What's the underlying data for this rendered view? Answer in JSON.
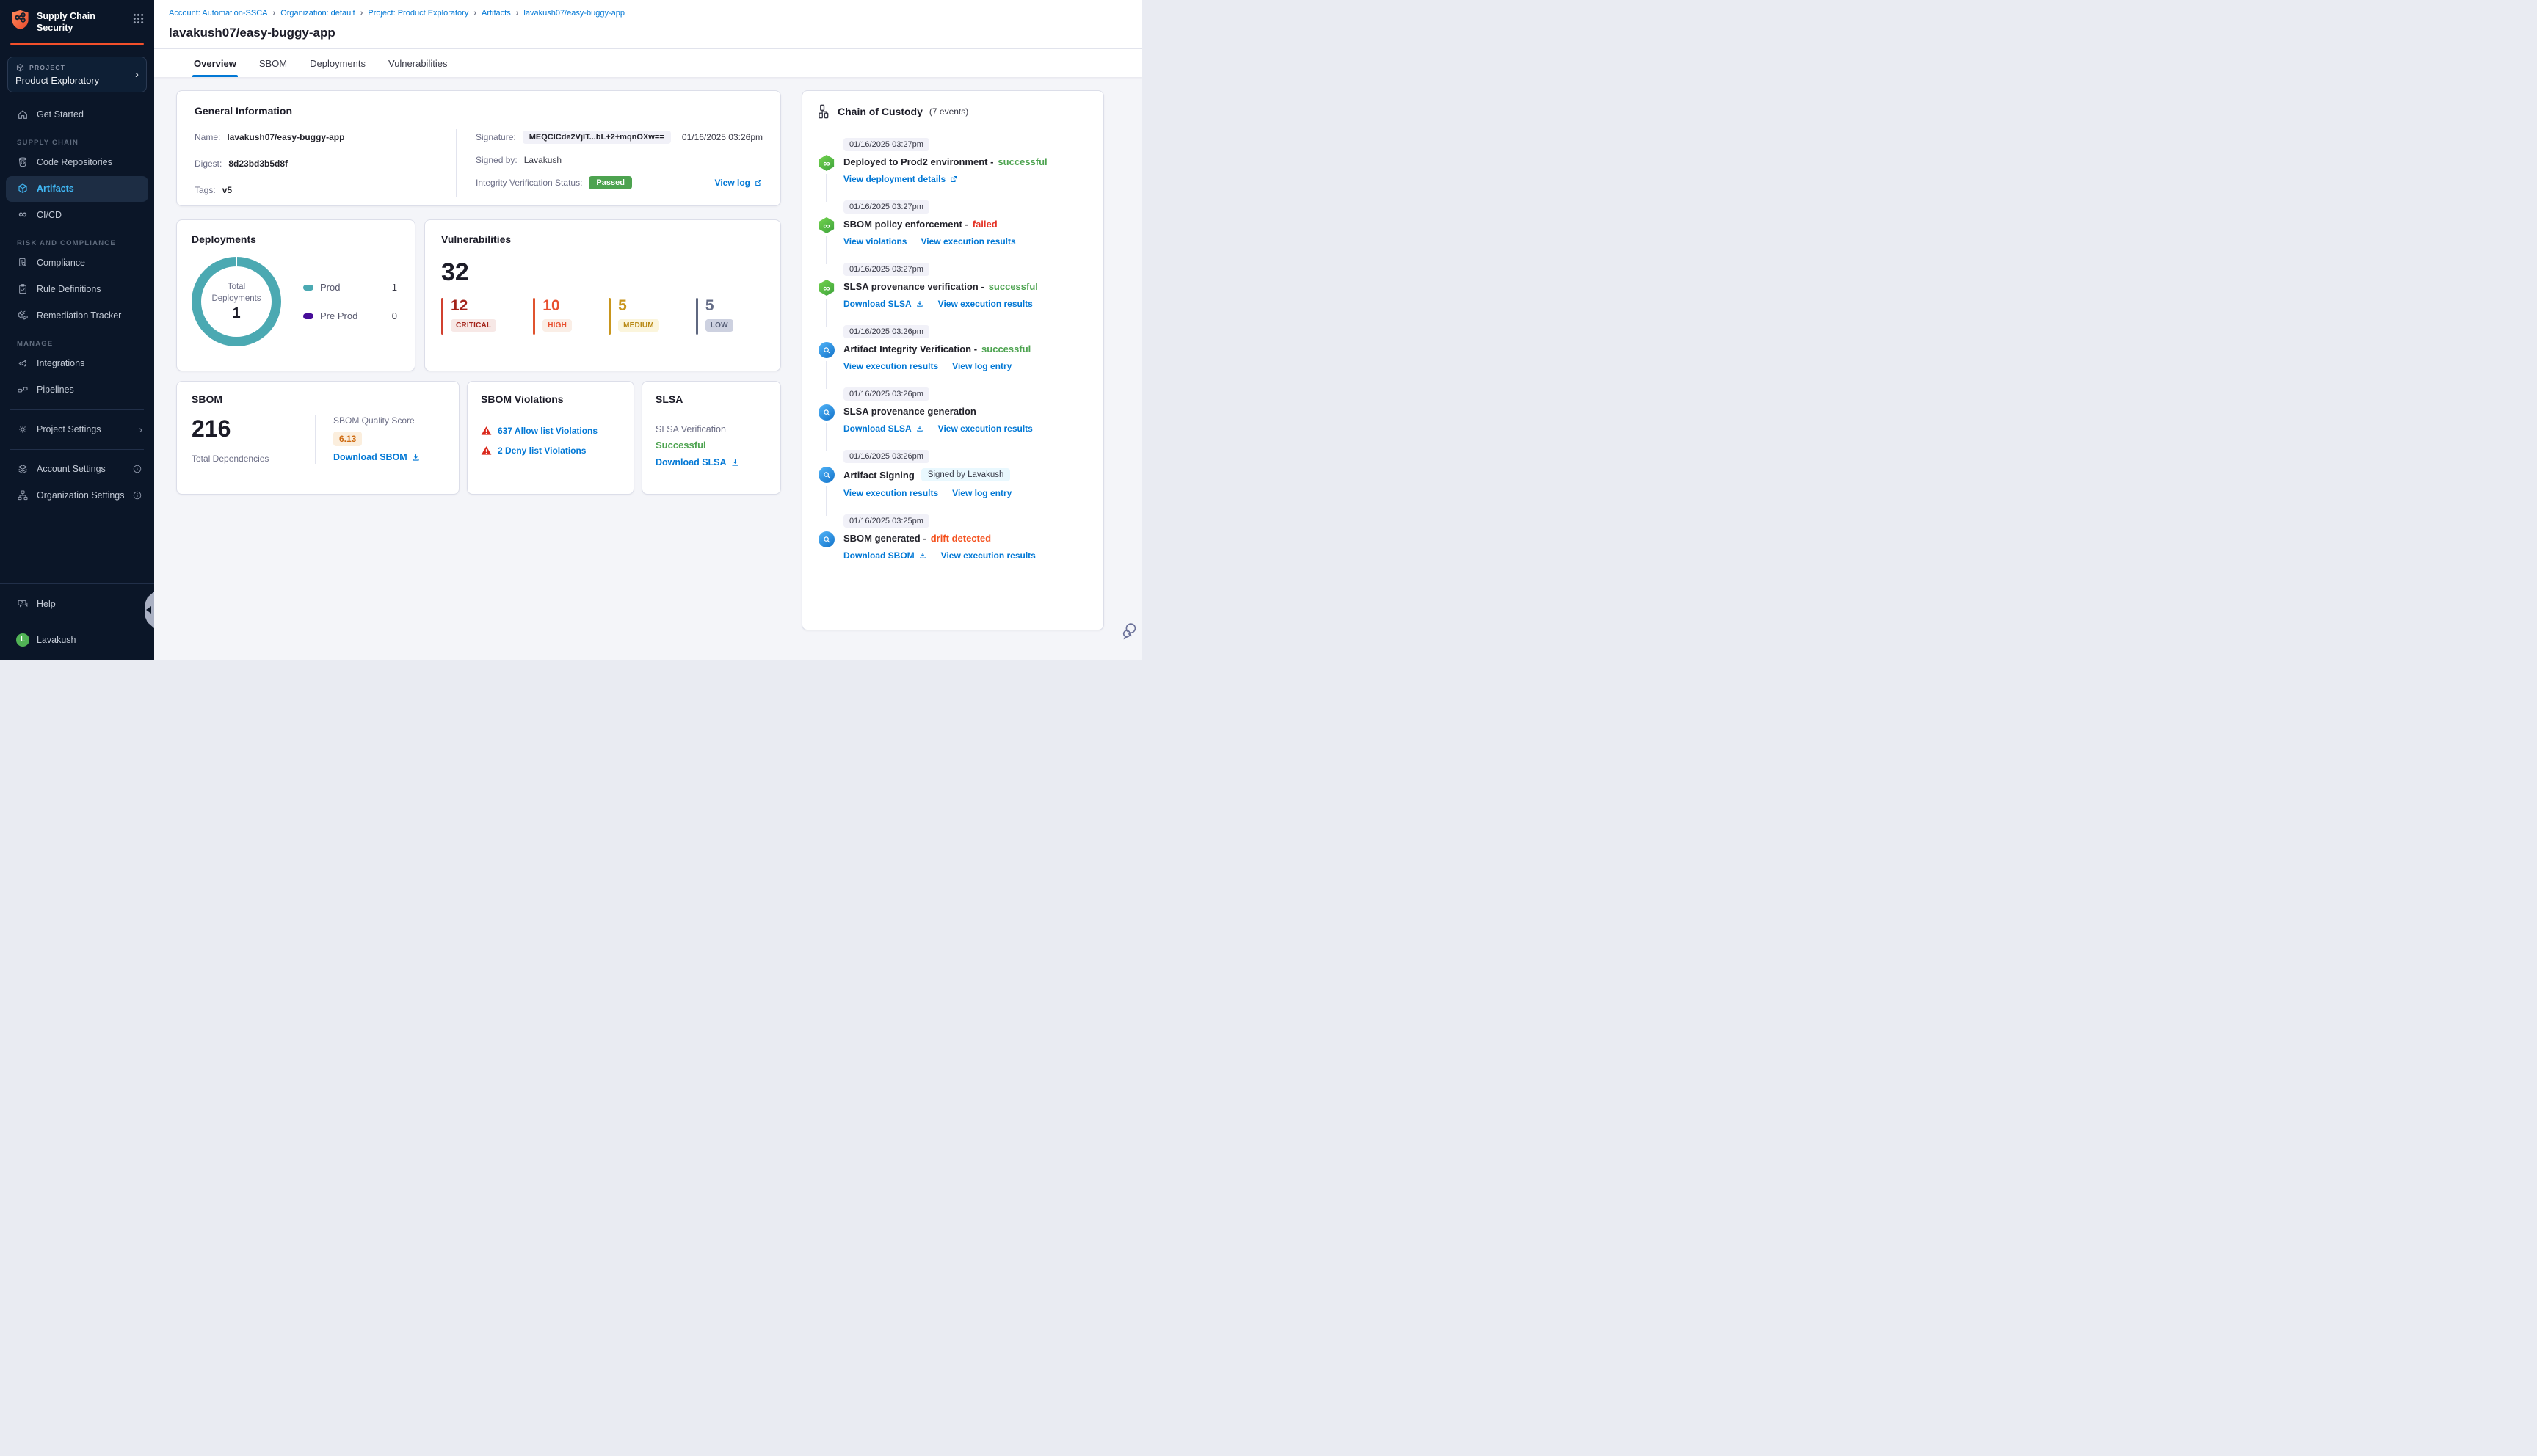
{
  "sidebar": {
    "app_title": "Supply Chain Security",
    "project_label": "PROJECT",
    "project_name": "Product Exploratory",
    "get_started_label": "Get Started",
    "sections": [
      {
        "label": "SUPPLY CHAIN",
        "items": [
          {
            "label": "Code Repositories"
          },
          {
            "label": "Artifacts"
          },
          {
            "label": "CI/CD"
          }
        ]
      },
      {
        "label": "RISK AND COMPLIANCE",
        "items": [
          {
            "label": "Compliance"
          },
          {
            "label": "Rule Definitions"
          },
          {
            "label": "Remediation Tracker"
          }
        ]
      },
      {
        "label": "MANAGE",
        "items": [
          {
            "label": "Integrations"
          },
          {
            "label": "Pipelines"
          }
        ]
      }
    ],
    "project_settings_label": "Project Settings",
    "account_settings_label": "Account Settings",
    "organization_settings_label": "Organization Settings",
    "help_label": "Help",
    "user_name": "Lavakush",
    "user_initial": "L"
  },
  "breadcrumb": {
    "items": [
      "Account: Automation-SSCA",
      "Organization: default",
      "Project: Product Exploratory",
      "Artifacts",
      "lavakush07/easy-buggy-app"
    ]
  },
  "page_title": "lavakush07/easy-buggy-app",
  "tabs": [
    "Overview",
    "SBOM",
    "Deployments",
    "Vulnerabilities"
  ],
  "general_info": {
    "title": "General Information",
    "name_label": "Name:",
    "name_value": "lavakush07/easy-buggy-app",
    "digest_label": "Digest:",
    "digest_value": "8d23bd3b5d8f",
    "tags_label": "Tags:",
    "tags_value": "v5",
    "signature_label": "Signature:",
    "signature_value": "MEQCICde2VjIT...bL+2+mqnOXw==",
    "signature_timestamp": "01/16/2025 03:26pm",
    "signed_by_label": "Signed by:",
    "signed_by_value": "Lavakush",
    "integrity_label": "Integrity Verification Status:",
    "integrity_status": "Passed",
    "view_log_label": "View log"
  },
  "deployments": {
    "title": "Deployments",
    "center_label": "Total Deployments",
    "total": "1",
    "legend": [
      {
        "label": "Prod",
        "value": "1",
        "color": "#4BA9B2"
      },
      {
        "label": "Pre Prod",
        "value": "0",
        "color": "#470D99"
      }
    ]
  },
  "vulnerabilities": {
    "title": "Vulnerabilities",
    "total": "32",
    "severities": [
      {
        "label": "CRITICAL",
        "count": "12",
        "color": "#A3231A"
      },
      {
        "label": "HIGH",
        "count": "10",
        "color": "#E8502F"
      },
      {
        "label": "MEDIUM",
        "count": "5",
        "color": "#C9961D"
      },
      {
        "label": "LOW",
        "count": "5",
        "color": "#656D87"
      }
    ]
  },
  "sbom": {
    "title": "SBOM",
    "total": "216",
    "total_label": "Total Dependencies",
    "quality_label": "SBOM Quality Score",
    "quality_value": "6.13",
    "download_label": "Download SBOM"
  },
  "sbom_violations": {
    "title": "SBOM Violations",
    "items": [
      {
        "label": "637 Allow list Violations"
      },
      {
        "label": "2 Deny list Violations"
      }
    ]
  },
  "slsa": {
    "title": "SLSA",
    "verification_label": "SLSA Verification",
    "status": "Successful",
    "download_label": "Download SLSA"
  },
  "custody": {
    "title": "Chain of Custody",
    "count": "(7 events)",
    "events": [
      {
        "timestamp": "01/16/2025 03:27pm",
        "title": "Deployed to Prod2 environment -",
        "status": "successful",
        "links": [
          {
            "label": "View deployment details"
          }
        ]
      },
      {
        "timestamp": "01/16/2025 03:27pm",
        "title": "SBOM policy enforcement -",
        "status": "failed",
        "links": [
          {
            "label": "View violations"
          },
          {
            "label": "View execution results"
          }
        ]
      },
      {
        "timestamp": "01/16/2025 03:27pm",
        "title": "SLSA provenance verification -",
        "status": "successful",
        "links": [
          {
            "label": "Download SLSA"
          },
          {
            "label": "View execution results"
          }
        ]
      },
      {
        "timestamp": "01/16/2025 03:26pm",
        "title": "Artifact Integrity Verification -",
        "status": "successful",
        "links": [
          {
            "label": "View execution results"
          },
          {
            "label": "View log entry"
          }
        ]
      },
      {
        "timestamp": "01/16/2025 03:26pm",
        "title": "SLSA provenance generation",
        "status": "",
        "links": [
          {
            "label": "Download SLSA"
          },
          {
            "label": "View execution results"
          }
        ]
      },
      {
        "timestamp": "01/16/2025 03:26pm",
        "title": "Artifact Signing",
        "status": "",
        "badge": "Signed by Lavakush",
        "links": [
          {
            "label": "View execution results"
          },
          {
            "label": "View log entry"
          }
        ]
      },
      {
        "timestamp": "01/16/2025 03:25pm",
        "title": "SBOM generated -",
        "status": "drift detected",
        "links": [
          {
            "label": "Download SBOM"
          },
          {
            "label": "View execution results"
          }
        ]
      }
    ]
  },
  "chart_data": {
    "type": "pie",
    "title": "Deployments",
    "labels": [
      "Prod",
      "Pre Prod"
    ],
    "values": [
      1,
      0
    ],
    "colors": [
      "#4BA9B2",
      "#470D99"
    ],
    "center_label": "Total Deployments",
    "center_value": 1,
    "legend_position": "right"
  },
  "colors": {
    "accent_blue": "#0278D5",
    "sidebar_bg": "#0B1628",
    "brand_orange": "#F4502B",
    "active_item_blue": "#41B8F5",
    "success_green": "#4DA350",
    "error_red": "#E43326",
    "drift_orange": "#F4511E",
    "teal": "#4BA9B2",
    "purple": "#470D99",
    "critical": "#A3231A",
    "high": "#E8502F",
    "medium": "#C9961D",
    "low": "#656D87",
    "passed_badge_green": "#4DA350",
    "avatar_green": "#51B355"
  }
}
